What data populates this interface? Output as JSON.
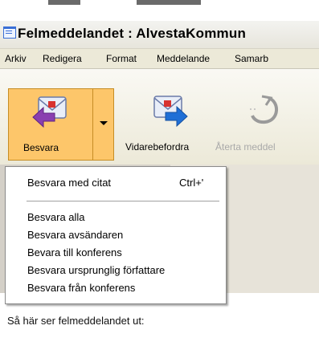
{
  "window": {
    "title": "Felmeddelandet : AlvestaKommun"
  },
  "menubar": {
    "items": [
      {
        "label": "Arkiv"
      },
      {
        "label": "Redigera"
      },
      {
        "label": "Format"
      },
      {
        "label": "Meddelande"
      },
      {
        "label": "Samarb"
      }
    ]
  },
  "toolbar": {
    "reply_label": "Besvara",
    "forward_label": "Vidarebefordra",
    "recall_label": "Återta meddel"
  },
  "reply_menu": {
    "items": [
      {
        "label": "Besvara med citat",
        "shortcut": "Ctrl+'"
      },
      {
        "label": "Besvara alla"
      },
      {
        "label": "Besvara avsändaren"
      },
      {
        "label": "Bevara till konferens"
      },
      {
        "label": "Besvara ursprunglig författare"
      },
      {
        "label": "Besvara från konferens"
      }
    ]
  },
  "body": {
    "text": "Så här ser felmeddelandet ut:"
  },
  "icons": {
    "app": "message-icon",
    "reply": "reply-icon",
    "forward": "forward-icon",
    "recall": "recall-icon",
    "dropdown": "chevron-down-icon"
  },
  "colors": {
    "hover_border": "#c68d25",
    "hover_fill": "#fdc66a",
    "menubar": "#ece9d8"
  }
}
